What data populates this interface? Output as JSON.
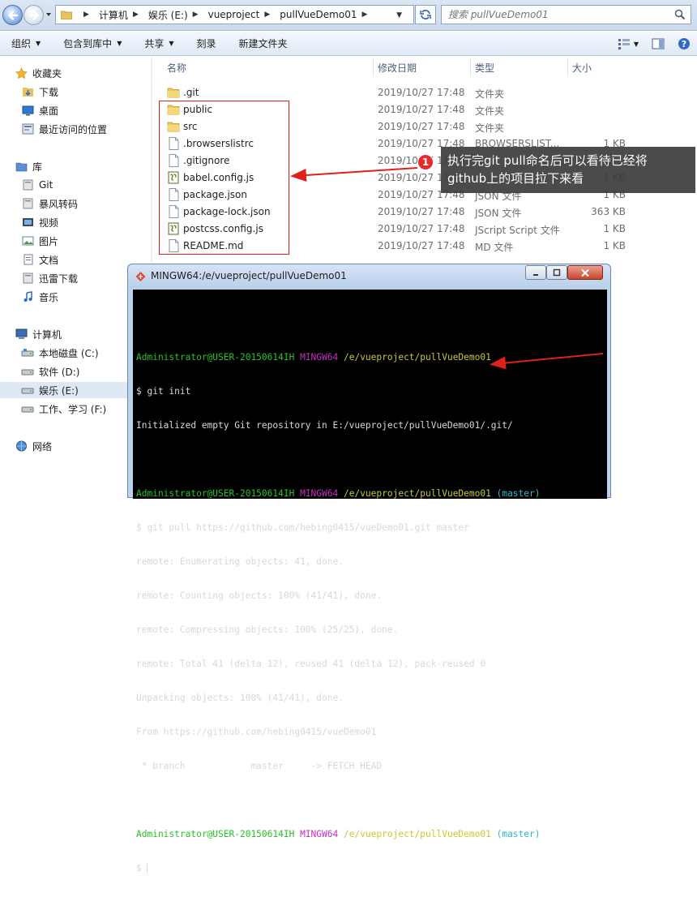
{
  "address": {
    "crumbs": [
      "计算机",
      "娱乐 (E:)",
      "vueproject",
      "pullVueDemo01"
    ],
    "search_placeholder": "搜索 pullVueDemo01"
  },
  "toolbar": {
    "organize": "组织",
    "include_in_library": "包含到库中",
    "share": "共享",
    "burn": "刻录",
    "new_folder": "新建文件夹"
  },
  "sidebar": {
    "favorites": "收藏夹",
    "fav_items": [
      "下载",
      "桌面",
      "最近访问的位置"
    ],
    "libraries": "库",
    "lib_items": [
      "Git",
      "暴风转码",
      "视频",
      "图片",
      "文档",
      "迅雷下载",
      "音乐"
    ],
    "computer": "计算机",
    "drives": [
      "本地磁盘 (C:)",
      "软件 (D:)",
      "娱乐 (E:)",
      "工作、学习 (F:)"
    ],
    "network": "网络"
  },
  "columns": {
    "name": "名称",
    "modified": "修改日期",
    "type": "类型",
    "size": "大小"
  },
  "files": [
    {
      "name": ".git",
      "date": "2019/10/27 17:48",
      "type": "文件夹",
      "size": "",
      "icon": "folder-icon"
    },
    {
      "name": "public",
      "date": "2019/10/27 17:48",
      "type": "文件夹",
      "size": "",
      "icon": "folder-icon"
    },
    {
      "name": "src",
      "date": "2019/10/27 17:48",
      "type": "文件夹",
      "size": "",
      "icon": "folder-icon"
    },
    {
      "name": ".browserslistrc",
      "date": "2019/10/27 17:48",
      "type": "BROWSERSLIST...",
      "size": "1 KB",
      "icon": "file-icon"
    },
    {
      "name": ".gitignore",
      "date": "2019/10/27 17:48",
      "type": "",
      "size": "",
      "icon": "file-icon"
    },
    {
      "name": "babel.config.js",
      "date": "2019/10/27 17:48",
      "type": "",
      "size": "1 KB",
      "icon": "script-file-icon"
    },
    {
      "name": "package.json",
      "date": "2019/10/27 17:48",
      "type": "JSON 文件",
      "size": "1 KB",
      "icon": "file-icon"
    },
    {
      "name": "package-lock.json",
      "date": "2019/10/27 17:48",
      "type": "JSON 文件",
      "size": "363 KB",
      "icon": "file-icon"
    },
    {
      "name": "postcss.config.js",
      "date": "2019/10/27 17:48",
      "type": "JScript Script 文件",
      "size": "1 KB",
      "icon": "script-file-icon"
    },
    {
      "name": "README.md",
      "date": "2019/10/27 17:48",
      "type": "MD 文件",
      "size": "1 KB",
      "icon": "file-icon"
    }
  ],
  "callout": {
    "number": "1",
    "line1": "执行完git pull命名后可以看待已经将",
    "line2": "github上的项目拉下来看"
  },
  "terminal": {
    "title": "MINGW64:/e/vueproject/pullVueDemo01",
    "user": "Administrator@USER-20150614IH",
    "shell": "MINGW64",
    "path": "/e/vueproject/pullVueDemo01",
    "branch": "(master)",
    "cmd1": "$ git init",
    "out1": "Initialized empty Git repository in E:/vueproject/pullVueDemo01/.git/",
    "cmd2": "$ git pull https://github.com/hebing0415/vueDemo01.git master",
    "out2": [
      "remote: Enumerating objects: 41, done.",
      "remote: Counting objects: 100% (41/41), done.",
      "remote: Compressing objects: 100% (25/25), done.",
      "remote: Total 41 (delta 12), reused 41 (delta 12), pack-reused 0",
      "Unpacking objects: 100% (41/41), done.",
      "From https://github.com/hebing0415/vueDemo01",
      " * branch            master     -> FETCH_HEAD"
    ],
    "prompt": "$ "
  }
}
